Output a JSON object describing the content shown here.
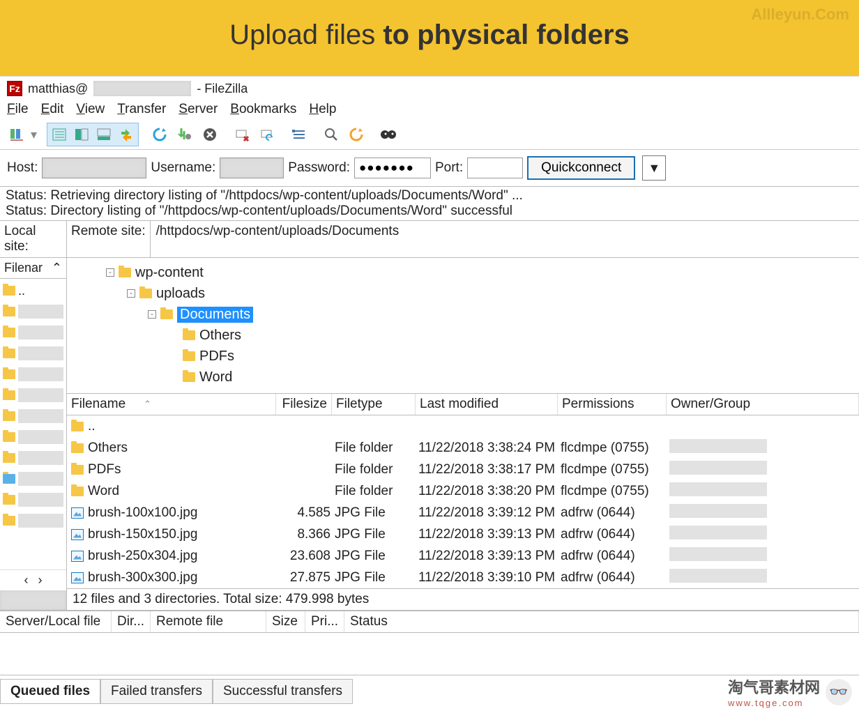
{
  "banner": {
    "title_pre": "Upload files ",
    "title_bold": "to physical folders",
    "watermark": "Allleyun.Com"
  },
  "window": {
    "title_user": "matthias@",
    "title_app": " - FileZilla"
  },
  "menubar": [
    "File",
    "Edit",
    "View",
    "Transfer",
    "Server",
    "Bookmarks",
    "Help"
  ],
  "quickconnect": {
    "host_label": "Host:",
    "user_label": "Username:",
    "pass_label": "Password:",
    "port_label": "Port:",
    "password_mask": "●●●●●●●",
    "button": "Quickconnect"
  },
  "status_log": [
    "Status:   Retrieving directory listing of \"/httpdocs/wp-content/uploads/Documents/Word\" ...",
    "Status:   Directory listing of \"/httpdocs/wp-content/uploads/Documents/Word\" successful"
  ],
  "sitebar": {
    "local_label": "Local site:",
    "remote_label": "Remote site:",
    "remote_path": "/httpdocs/wp-content/uploads/Documents"
  },
  "localcol": {
    "head": "Filenar",
    "parent": ".."
  },
  "tree": {
    "items": [
      {
        "indent": 0,
        "expander": "-",
        "label": "wp-content"
      },
      {
        "indent": 1,
        "expander": "-",
        "label": "uploads"
      },
      {
        "indent": 2,
        "expander": "-",
        "label": "Documents",
        "selected": true
      },
      {
        "indent": 3,
        "expander": "",
        "label": "Others"
      },
      {
        "indent": 3,
        "expander": "",
        "label": "PDFs"
      },
      {
        "indent": 3,
        "expander": "",
        "label": "Word"
      }
    ]
  },
  "filegrid": {
    "columns": {
      "name": "Filename",
      "size": "Filesize",
      "type": "Filetype",
      "mod": "Last modified",
      "perm": "Permissions",
      "own": "Owner/Group"
    },
    "parent": "..",
    "rows": [
      {
        "icon": "folder",
        "name": "Others",
        "size": "",
        "type": "File folder",
        "mod": "11/22/2018 3:38:24 PM",
        "perm": "flcdmpe (0755)"
      },
      {
        "icon": "folder",
        "name": "PDFs",
        "size": "",
        "type": "File folder",
        "mod": "11/22/2018 3:38:17 PM",
        "perm": "flcdmpe (0755)"
      },
      {
        "icon": "folder",
        "name": "Word",
        "size": "",
        "type": "File folder",
        "mod": "11/22/2018 3:38:20 PM",
        "perm": "flcdmpe (0755)"
      },
      {
        "icon": "image",
        "name": "brush-100x100.jpg",
        "size": "4.585",
        "type": "JPG File",
        "mod": "11/22/2018 3:39:12 PM",
        "perm": "adfrw (0644)"
      },
      {
        "icon": "image",
        "name": "brush-150x150.jpg",
        "size": "8.366",
        "type": "JPG File",
        "mod": "11/22/2018 3:39:13 PM",
        "perm": "adfrw (0644)"
      },
      {
        "icon": "image",
        "name": "brush-250x304.jpg",
        "size": "23.608",
        "type": "JPG File",
        "mod": "11/22/2018 3:39:13 PM",
        "perm": "adfrw (0644)"
      },
      {
        "icon": "image",
        "name": "brush-300x300.jpg",
        "size": "27.875",
        "type": "JPG File",
        "mod": "11/22/2018 3:39:10 PM",
        "perm": "adfrw (0644)"
      }
    ],
    "summary": "12 files and 3 directories. Total size: 479.998 bytes"
  },
  "queue": {
    "columns": [
      "Server/Local file",
      "Dir...",
      "Remote file",
      "Size",
      "Pri...",
      "Status"
    ]
  },
  "tabs": [
    "Queued files",
    "Failed transfers",
    "Successful transfers"
  ],
  "footer": {
    "text": "淘气哥素材网",
    "url": "www.tqge.com"
  }
}
